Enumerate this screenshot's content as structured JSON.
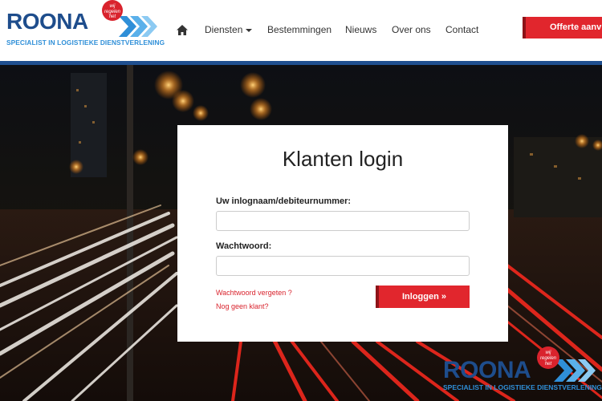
{
  "brand": {
    "name": "ROONA",
    "tagline": "SPECIALIST IN LOGISTIEKE DIENSTVERLENING",
    "badge_line1": "wij",
    "badge_line2": "regelen",
    "badge_line3": "het",
    "primary_color": "#1e4d8c",
    "accent_color": "#e1262d"
  },
  "nav": {
    "home_icon": "home-icon",
    "items": [
      {
        "label": "Diensten"
      },
      {
        "label": "Bestemmingen"
      },
      {
        "label": "Nieuws"
      },
      {
        "label": "Over ons"
      },
      {
        "label": "Contact"
      }
    ],
    "cta_label": "Offerte aanvraag"
  },
  "login": {
    "title": "Klanten login",
    "username_label": "Uw inlognaam/debiteurnummer:",
    "username_value": "",
    "password_label": "Wachtwoord:",
    "password_value": "",
    "forgot_link": "Wachtwoord vergeten ?",
    "register_link": "Nog geen klant?",
    "submit_label": "Inloggen »"
  }
}
